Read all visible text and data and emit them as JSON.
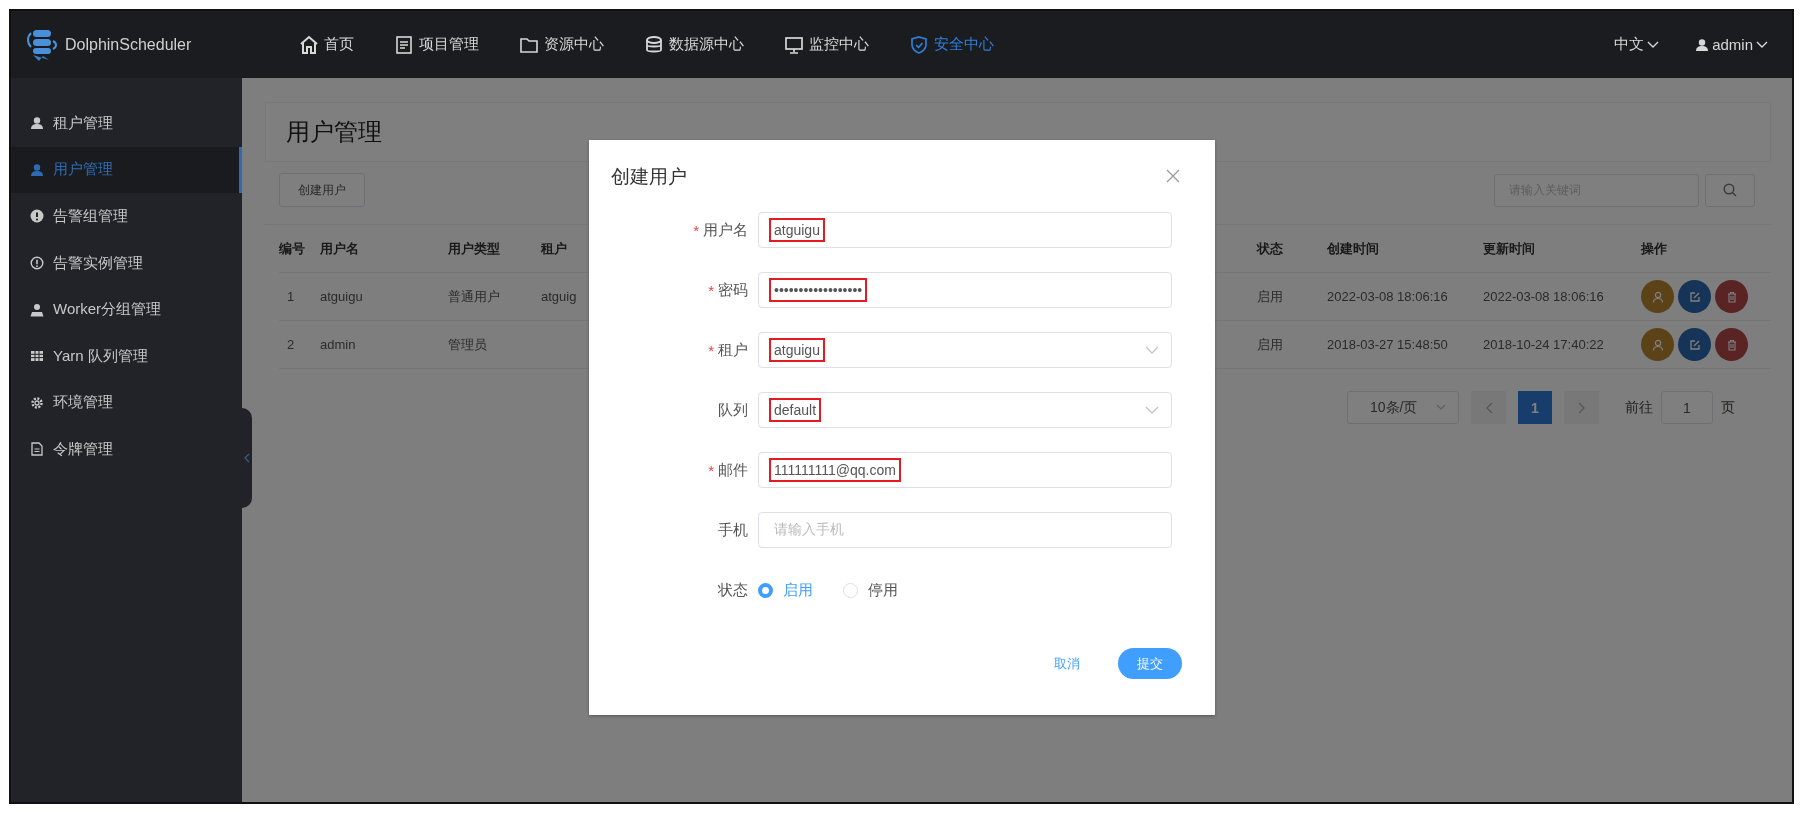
{
  "header": {
    "logo": "DolphinScheduler",
    "nav": [
      {
        "label": "首页",
        "selected": false
      },
      {
        "label": "项目管理",
        "selected": false
      },
      {
        "label": "资源中心",
        "selected": false
      },
      {
        "label": "数据源中心",
        "selected": false
      },
      {
        "label": "监控中心",
        "selected": false
      },
      {
        "label": "安全中心",
        "selected": true
      }
    ],
    "language": "中文",
    "user": "admin"
  },
  "sidebar": {
    "items": [
      {
        "label": "租户管理",
        "selected": false
      },
      {
        "label": "用户管理",
        "selected": true
      },
      {
        "label": "告警组管理",
        "selected": false
      },
      {
        "label": "告警实例管理",
        "selected": false
      },
      {
        "label": "Worker分组管理",
        "selected": false
      },
      {
        "label": "Yarn 队列管理",
        "selected": false
      },
      {
        "label": "环境管理",
        "selected": false
      },
      {
        "label": "令牌管理",
        "selected": false
      }
    ]
  },
  "page": {
    "title": "用户管理",
    "create_button": "创建用户",
    "search": {
      "placeholder": "请输入关键词"
    },
    "table": {
      "columns": [
        "编号",
        "用户名",
        "用户类型",
        "租户",
        "状态",
        "创建时间",
        "更新时间",
        "操作"
      ],
      "rows": [
        {
          "number": "1",
          "username": "atguigu",
          "user_type": "普通用户",
          "tenant": "atguig",
          "status": "启用",
          "created": "2022-03-08 18:06:16",
          "updated": "2022-03-08 18:06:16"
        },
        {
          "number": "2",
          "username": "admin",
          "user_type": "管理员",
          "status": "启用",
          "created": "2018-03-27 15:48:50",
          "updated": "2018-10-24 17:40:22"
        }
      ]
    },
    "pagination": {
      "page_size": "10条/页",
      "pages": [
        {
          "label": "1",
          "selected": true
        }
      ],
      "goto_label": "前往",
      "goto_value": "1",
      "goto_suffix": "页"
    }
  },
  "dialog": {
    "title": "创建用户",
    "fields": [
      {
        "label": "用户名",
        "required_mark": "*",
        "kind": "input",
        "value": "atguigu",
        "highlighted": true
      },
      {
        "label": "密码",
        "required_mark": "*",
        "kind": "input",
        "value": "••••••••••••••••••",
        "highlighted": true
      },
      {
        "label": "租户",
        "required_mark": "*",
        "kind": "select",
        "value": "atguigu",
        "highlighted": true
      },
      {
        "label": "队列",
        "kind": "select",
        "value": "default",
        "highlighted": true
      },
      {
        "label": "邮件",
        "required_mark": "*",
        "kind": "input",
        "value": "111111111@qq.com",
        "highlighted": true
      },
      {
        "label": "手机",
        "kind": "input",
        "placeholder": "请输入手机",
        "highlighted": false
      }
    ],
    "status": {
      "label": "状态",
      "options": [
        {
          "label": "启用",
          "selected": true
        },
        {
          "label": "停用",
          "selected": false
        }
      ]
    },
    "cancel": "取消",
    "submit": "提交"
  }
}
